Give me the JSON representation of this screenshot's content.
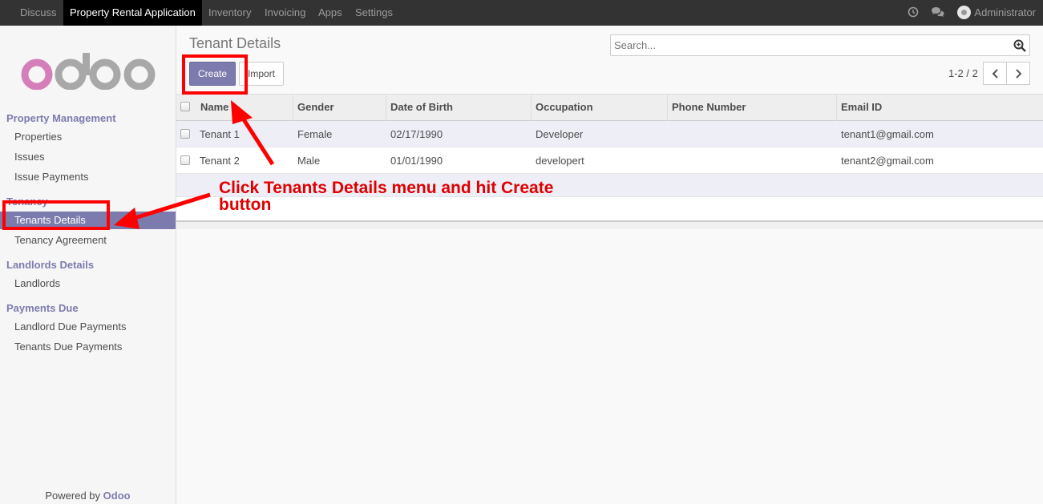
{
  "topbar": {
    "menus": [
      "Discuss",
      "Property Rental Application",
      "Inventory",
      "Invoicing",
      "Apps",
      "Settings"
    ],
    "user": "Administrator"
  },
  "sidebar": {
    "logo_text": "odoo",
    "sections": [
      {
        "title": "Property Management",
        "items": [
          "Properties",
          "Issues",
          "Issue Payments"
        ]
      },
      {
        "title": "Tenancy",
        "items": [
          "Tenants Details",
          "Tenancy Agreement"
        ]
      },
      {
        "title": "Landlords Details",
        "items": [
          "Landlords"
        ]
      },
      {
        "title": "Payments Due",
        "items": [
          "Landlord Due Payments",
          "Tenants Due Payments"
        ]
      }
    ],
    "powered_prefix": "Powered by",
    "powered_brand": "Odoo"
  },
  "main": {
    "title": "Tenant Details",
    "search_placeholder": "Search...",
    "create_label": "Create",
    "import_label": "Import",
    "pager": "1-2 / 2"
  },
  "table": {
    "columns": [
      "Name",
      "Gender",
      "Date of Birth",
      "Occupation",
      "Phone Number",
      "Email ID"
    ],
    "rows": [
      [
        "Tenant 1",
        "Female",
        "02/17/1990",
        "Developer",
        "",
        "tenant1@gmail.com"
      ],
      [
        "Tenant 2",
        "Male",
        "01/01/1990",
        "developert",
        "",
        "tenant2@gmail.com"
      ]
    ]
  },
  "annotation": {
    "text": "Click Tenants Details menu and hit Create button"
  },
  "colors": {
    "accent": "#7c7bad",
    "annotation": "#ff0000",
    "topbar": "#333333"
  }
}
